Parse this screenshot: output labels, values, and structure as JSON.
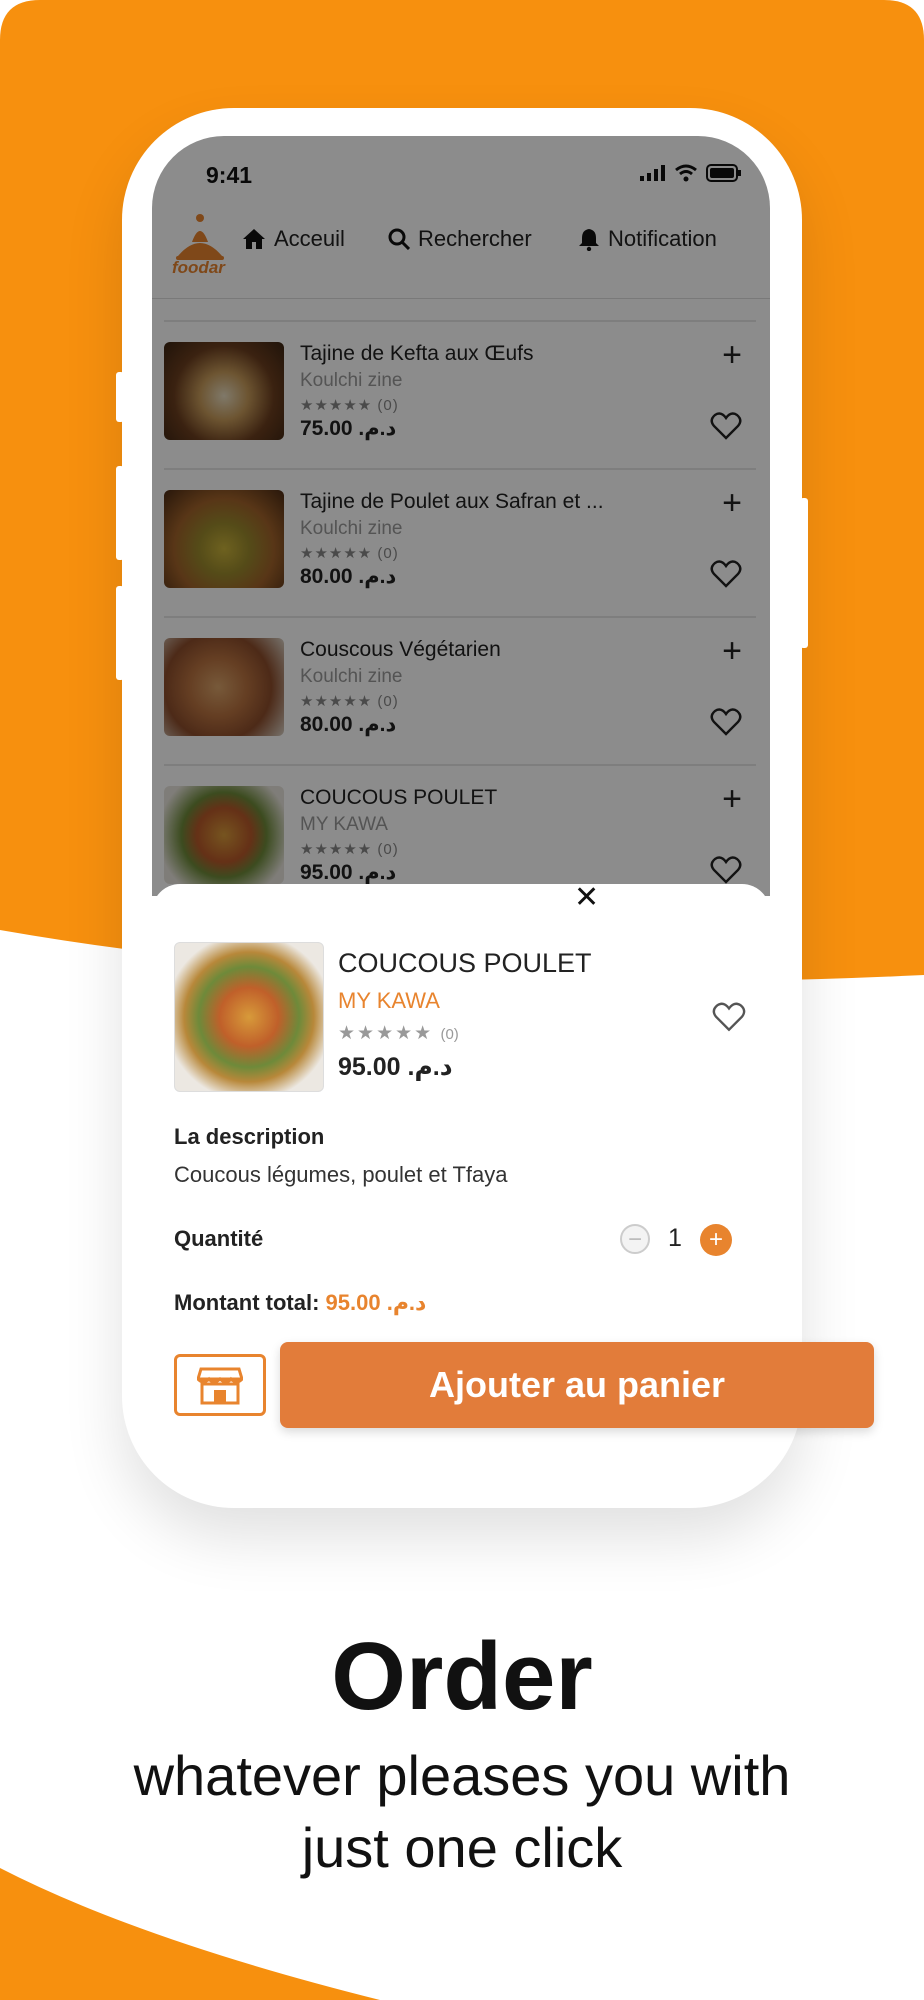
{
  "status": {
    "time": "9:41"
  },
  "nav": {
    "logo_text": "foodar",
    "items": [
      {
        "label": "Acceuil",
        "icon": "home-icon"
      },
      {
        "label": "Rechercher",
        "icon": "search-icon"
      },
      {
        "label": "Notification",
        "icon": "bell-icon"
      }
    ]
  },
  "list": {
    "items": [
      {
        "title": "Tajine de Kefta aux Œufs",
        "restaurant": "Koulchi zine",
        "rating": "(0)",
        "price": "75.00 .د.م"
      },
      {
        "title": "Tajine de Poulet aux Safran et ...",
        "restaurant": "Koulchi zine",
        "rating": "(0)",
        "price": "80.00 .د.م"
      },
      {
        "title": "Couscous Végétarien",
        "restaurant": "Koulchi zine",
        "rating": "(0)",
        "price": "80.00 .د.م"
      },
      {
        "title": "COUCOUS POULET",
        "restaurant": "MY KAWA",
        "rating": "(0)",
        "price": "95.00 .د.م"
      }
    ]
  },
  "product": {
    "title": "COUCOUS POULET",
    "restaurant": "MY KAWA",
    "rating": "(0)",
    "price": "95.00 .د.م",
    "description_label": "La description",
    "description": "Coucous légumes, poulet et Tfaya",
    "quantity_label": "Quantité",
    "quantity": "1",
    "total_label": "Montant total:",
    "total_value": "95.00 .د.م",
    "add_to_cart": "Ajouter au panier"
  },
  "promo": {
    "headline": "Order",
    "line1": "whatever pleases you with",
    "line2": "just one click"
  },
  "colors": {
    "accent": "#E8842E",
    "background_orange": "#F7900E"
  }
}
